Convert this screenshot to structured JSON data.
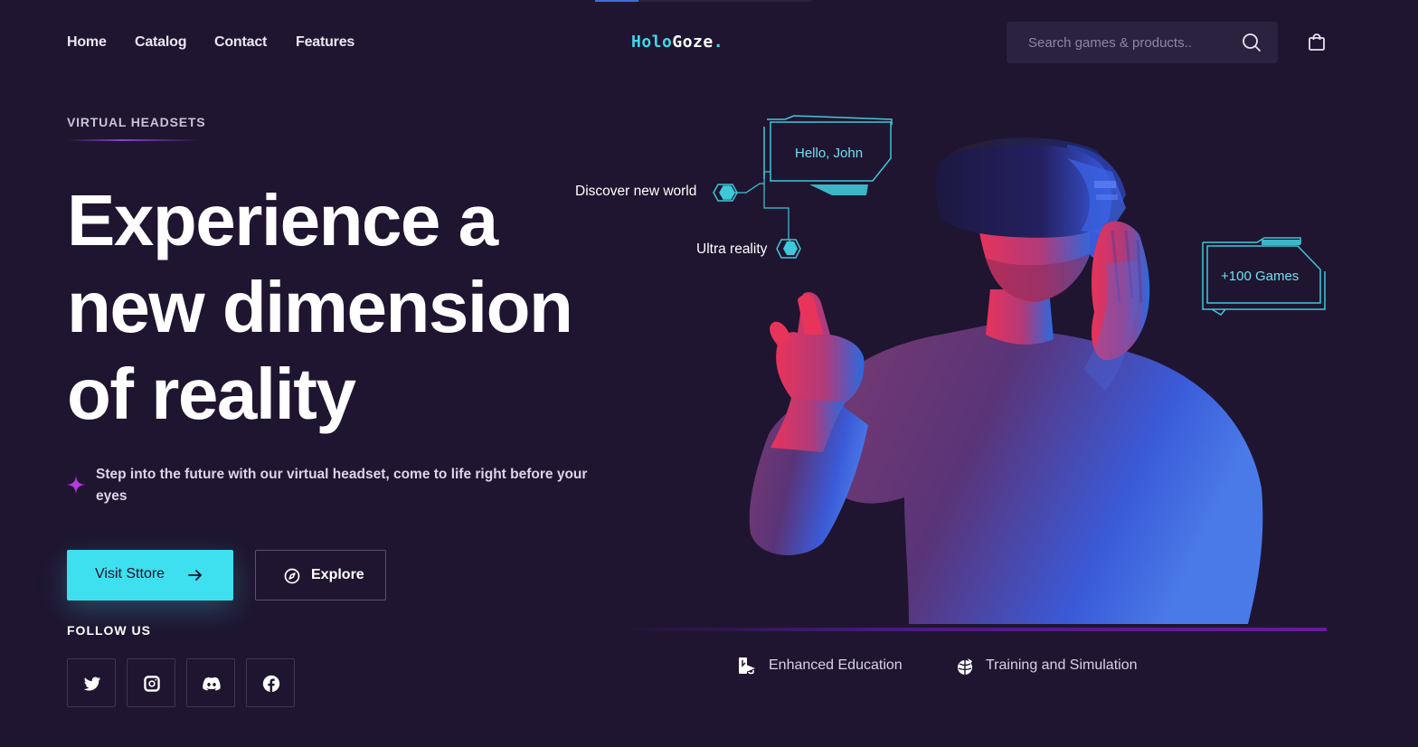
{
  "nav": {
    "links": [
      "Home",
      "Catalog",
      "Contact",
      "Features"
    ],
    "logo": {
      "part1": "Holo",
      "part2": "Goze",
      "part3": "."
    },
    "search_placeholder": "Search games & products.."
  },
  "hero": {
    "eyebrow": "VIRTUAL HEADSETS",
    "headline": "Experience a new dimension of reality",
    "description": "Step into the future with our virtual headset, come to life right before your eyes",
    "primary_button": "Visit Sttore",
    "secondary_button": "Explore",
    "follow_label": "FOLLOW US",
    "social": [
      "twitter-icon",
      "instagram-icon",
      "discord-icon",
      "facebook-icon"
    ]
  },
  "hud": {
    "greeting": "Hello, John",
    "tag_discover": "Discover new world",
    "tag_ultra": "Ultra reality",
    "games_badge": "+100 Games"
  },
  "features": [
    "Enhanced Education",
    "Training and Simulation"
  ],
  "colors": {
    "background": "#1f1530",
    "accent": "#3ee0ef",
    "purple": "#8a3fd0",
    "hud": "#3fc8d8"
  }
}
